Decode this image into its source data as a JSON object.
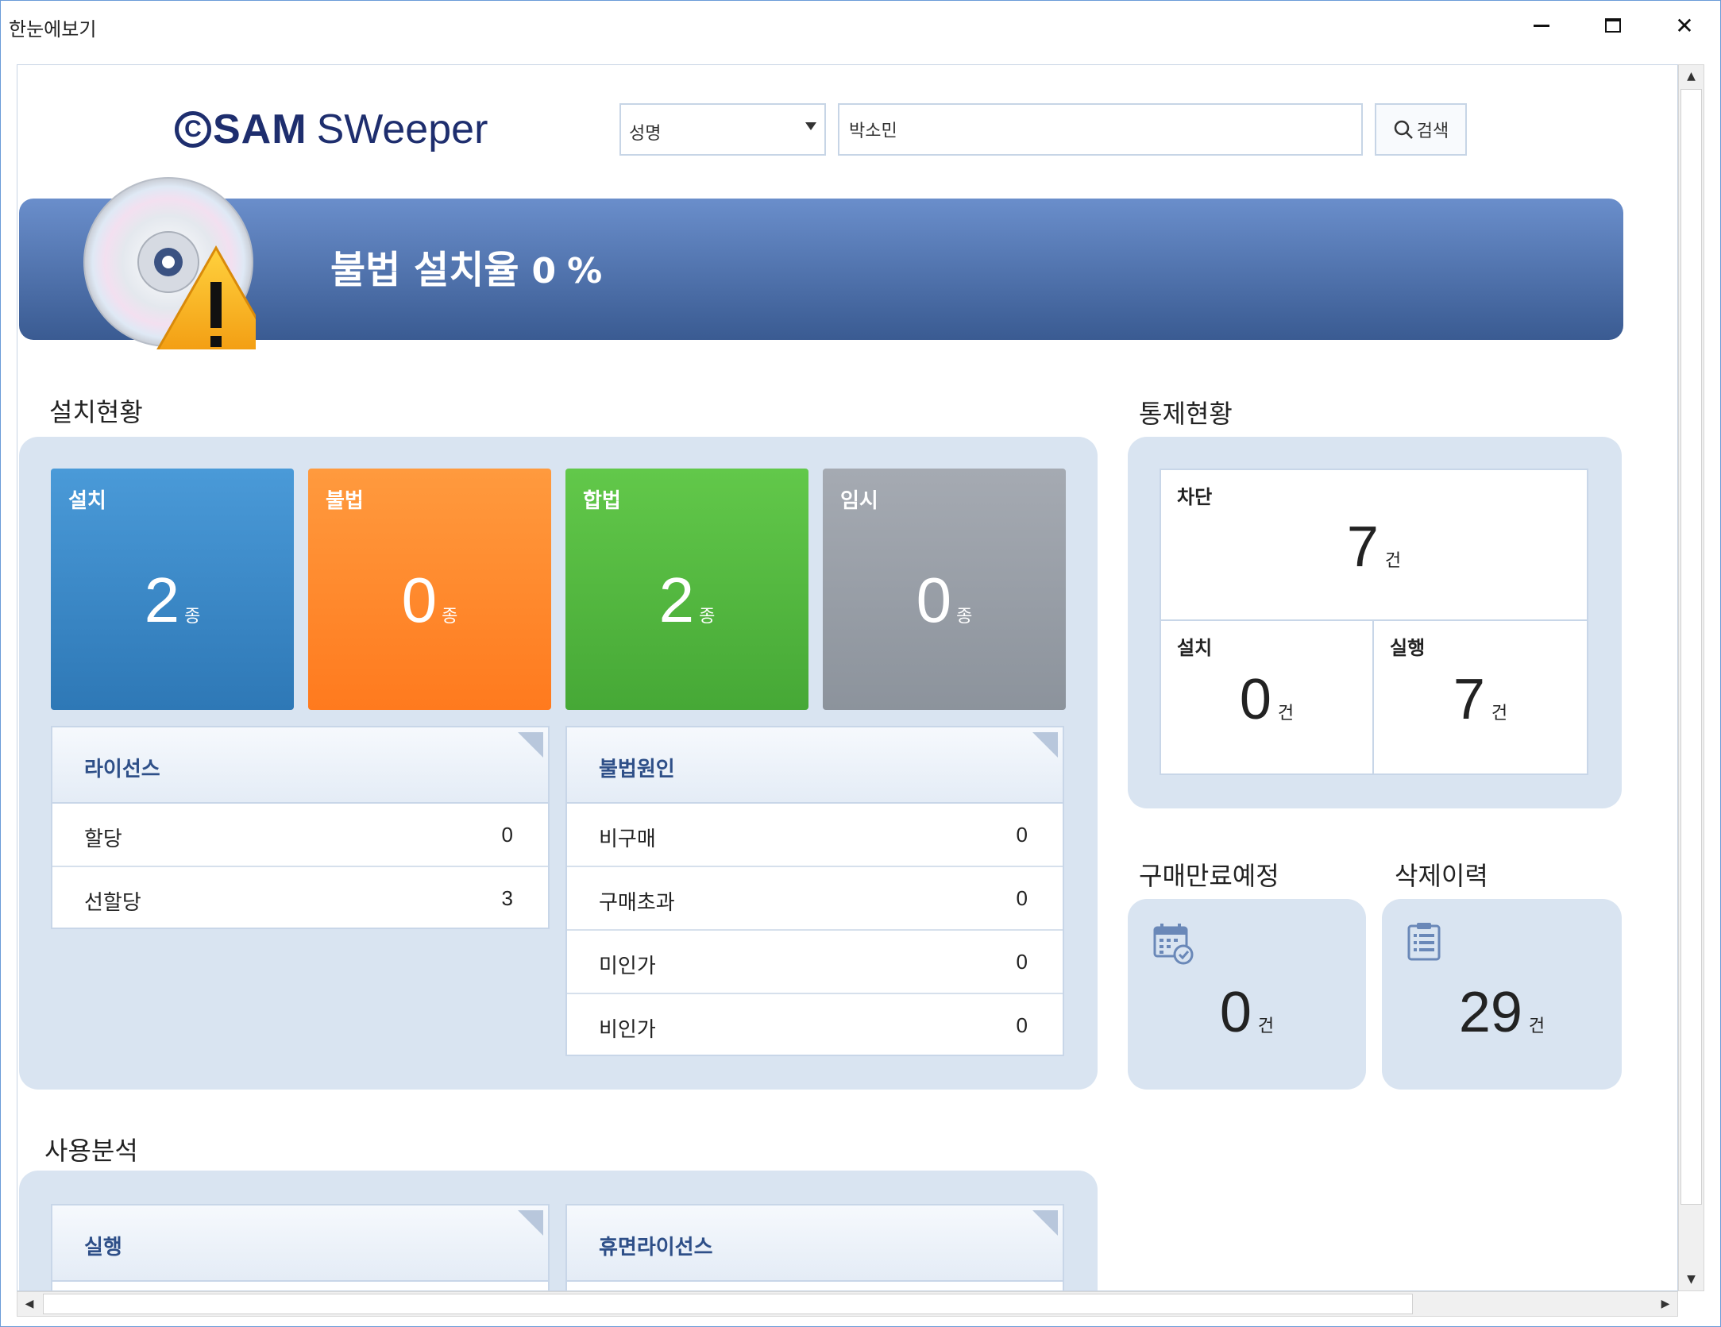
{
  "window": {
    "title": "한눈에보기"
  },
  "header": {
    "logo_sam": "SAM",
    "logo_sweeper": "SWeeper",
    "select_value": "성명",
    "search_value": "박소민",
    "search_button": "검색"
  },
  "banner": {
    "title": "불법 설치율",
    "rate": "0",
    "unit": "%"
  },
  "install": {
    "label": "설치현황",
    "tiles": [
      {
        "label": "설치",
        "value": "2",
        "unit": "종",
        "color": "#3a8bcb"
      },
      {
        "label": "불법",
        "value": "0",
        "unit": "종",
        "color": "#ff8a2e"
      },
      {
        "label": "합법",
        "value": "2",
        "unit": "종",
        "color": "#54b840"
      },
      {
        "label": "임시",
        "value": "0",
        "unit": "종",
        "color": "#9aa0a8"
      }
    ],
    "license": {
      "title": "라이선스",
      "rows": [
        {
          "label": "할당",
          "value": "0"
        },
        {
          "label": "선할당",
          "value": "3"
        }
      ]
    },
    "illegal_cause": {
      "title": "불법원인",
      "rows": [
        {
          "label": "비구매",
          "value": "0"
        },
        {
          "label": "구매초과",
          "value": "0"
        },
        {
          "label": "미인가",
          "value": "0"
        },
        {
          "label": "비인가",
          "value": "0"
        }
      ]
    }
  },
  "control": {
    "label": "통제현황",
    "block": {
      "label": "차단",
      "value": "7",
      "unit": "건"
    },
    "install": {
      "label": "설치",
      "value": "0",
      "unit": "건"
    },
    "run": {
      "label": "실행",
      "value": "7",
      "unit": "건"
    }
  },
  "purchase_expiry": {
    "label": "구매만료예정",
    "value": "0",
    "unit": "건",
    "icon": "calendar-icon"
  },
  "delete_history": {
    "label": "삭제이력",
    "value": "29",
    "unit": "건",
    "icon": "clipboard-icon"
  },
  "usage": {
    "label": "사용분석",
    "cards": [
      {
        "title": "실행"
      },
      {
        "title": "휴면라이선스"
      }
    ]
  }
}
